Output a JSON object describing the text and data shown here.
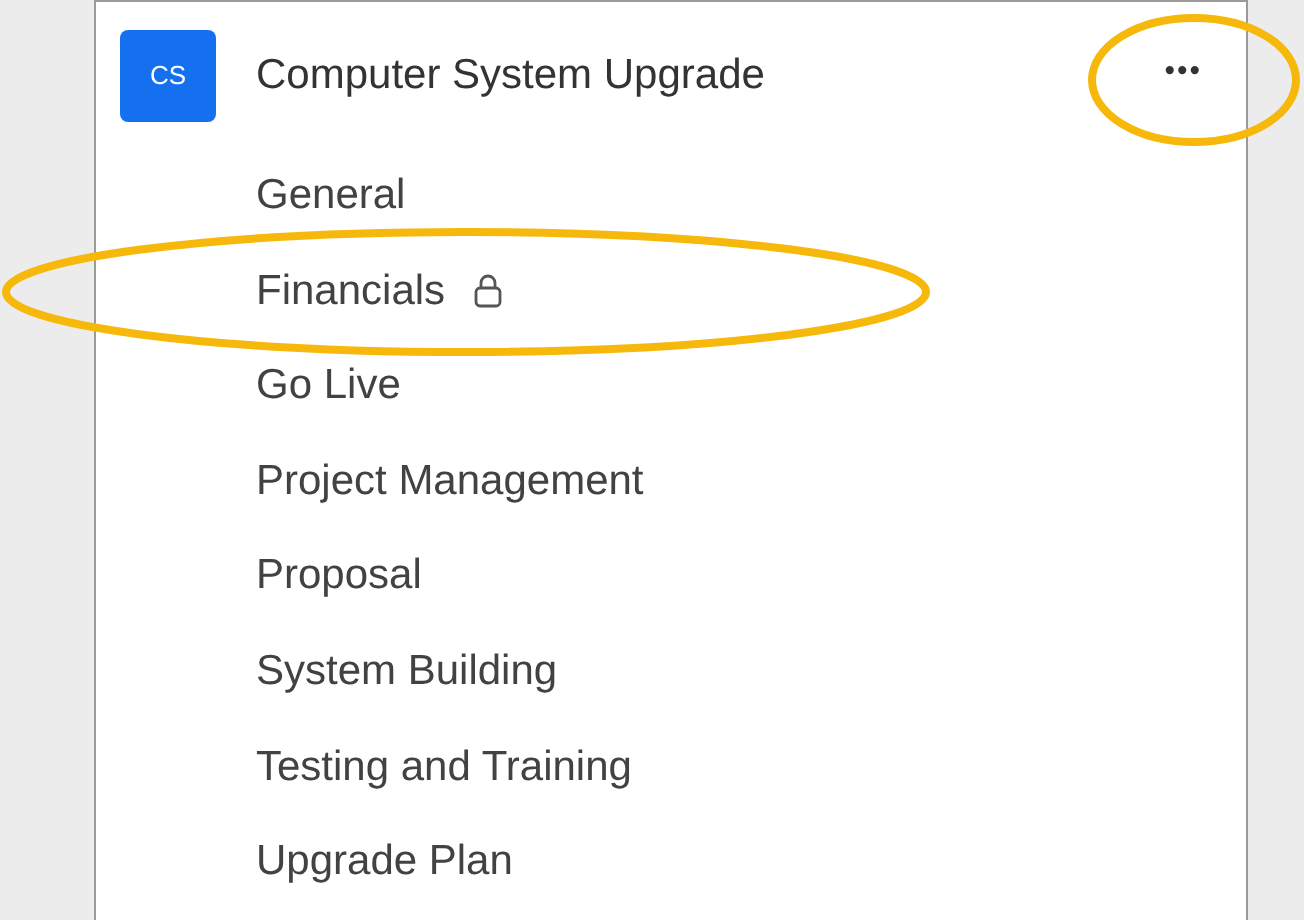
{
  "team": {
    "initials": "CS",
    "name": "Computer System Upgrade",
    "more": "•••",
    "more_highlighted": true
  },
  "channels": [
    {
      "name": "General",
      "locked": false,
      "highlighted": false
    },
    {
      "name": "Financials",
      "locked": true,
      "highlighted": true
    },
    {
      "name": "Go Live",
      "locked": false,
      "highlighted": false
    },
    {
      "name": "Project Management",
      "locked": false,
      "highlighted": false
    },
    {
      "name": "Proposal",
      "locked": false,
      "highlighted": false
    },
    {
      "name": "System Building",
      "locked": false,
      "highlighted": false
    },
    {
      "name": "Testing and Training",
      "locked": false,
      "highlighted": false
    },
    {
      "name": "Upgrade Plan",
      "locked": false,
      "highlighted": false
    }
  ]
}
